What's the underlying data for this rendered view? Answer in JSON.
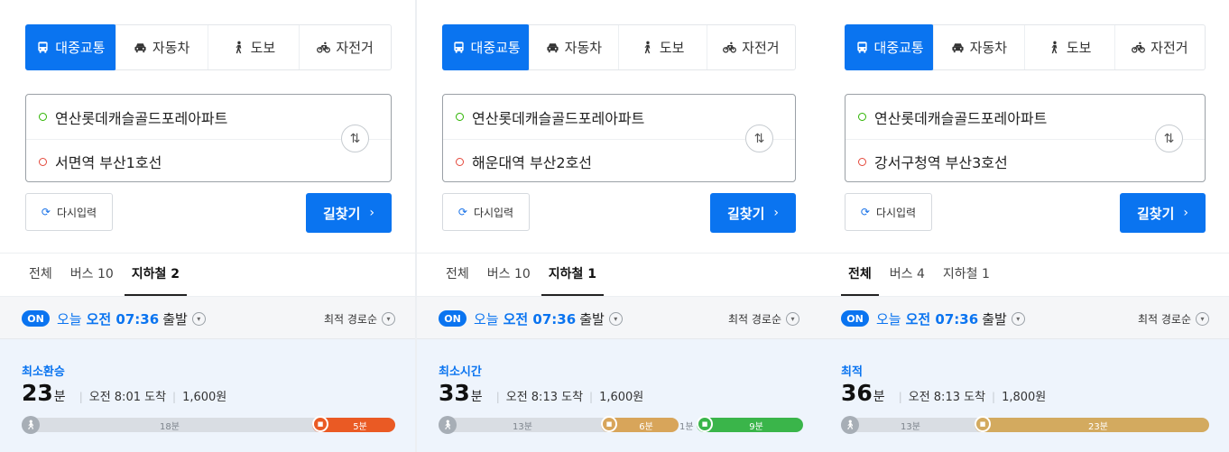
{
  "colors": {
    "primary": "#0a74f0",
    "start_dot": "#2db400",
    "end_dot": "#e4483b",
    "walk": "#d9dde3",
    "bus_orange": "#ea5a24",
    "subway_line2": "#d8a55a",
    "subway_line1": "#3ab54a",
    "subway_line3": "#d3aa5f"
  },
  "panels": [
    {
      "modes": [
        {
          "label": "대중교통",
          "icon": "bus-icon"
        },
        {
          "label": "자동차",
          "icon": "car-icon"
        },
        {
          "label": "도보",
          "icon": "walk-icon"
        },
        {
          "label": "자전거",
          "icon": "bike-icon"
        }
      ],
      "origin": "연산롯데캐슬골드포레아파트",
      "destination": "서면역 부산1호선",
      "reset_label": "다시입력",
      "search_label": "길찾기",
      "tabs": [
        {
          "label": "전체"
        },
        {
          "label": "버스 10"
        },
        {
          "label": "지하철 2"
        }
      ],
      "on_label": "ON",
      "depart": {
        "today": "오늘",
        "time": "오전 07:36",
        "suffix": "출발"
      },
      "sort_label": "최적 경로순",
      "result": {
        "label": "최소환승",
        "duration": "23",
        "duration_unit": "분",
        "arrival": "오전 8:01 도착",
        "fare": "1,600원",
        "segments": [
          {
            "type": "walk",
            "label": "18분",
            "minutes": 18
          },
          {
            "type": "bus",
            "label": "5분",
            "minutes": 5
          }
        ]
      }
    },
    {
      "modes": [
        {
          "label": "대중교통",
          "icon": "bus-icon"
        },
        {
          "label": "자동차",
          "icon": "car-icon"
        },
        {
          "label": "도보",
          "icon": "walk-icon"
        },
        {
          "label": "자전거",
          "icon": "bike-icon"
        }
      ],
      "origin": "연산롯데캐슬골드포레아파트",
      "destination": "해운대역 부산2호선",
      "reset_label": "다시입력",
      "search_label": "길찾기",
      "tabs": [
        {
          "label": "전체"
        },
        {
          "label": "버스 10"
        },
        {
          "label": "지하철 1"
        }
      ],
      "on_label": "ON",
      "depart": {
        "today": "오늘",
        "time": "오전 07:36",
        "suffix": "출발"
      },
      "sort_label": "최적 경로순",
      "result": {
        "label": "최소시간",
        "duration": "33",
        "duration_unit": "분",
        "arrival": "오전 8:13 도착",
        "fare": "1,600원",
        "segments": [
          {
            "type": "walk",
            "label": "13분",
            "minutes": 13
          },
          {
            "type": "subway2",
            "label": "6분",
            "minutes": 6
          },
          {
            "type": "walk",
            "label": "1분",
            "minutes": 1
          },
          {
            "type": "subway1",
            "label": "9분",
            "minutes": 9
          }
        ]
      }
    },
    {
      "modes": [
        {
          "label": "대중교통",
          "icon": "bus-icon"
        },
        {
          "label": "자동차",
          "icon": "car-icon"
        },
        {
          "label": "도보",
          "icon": "walk-icon"
        },
        {
          "label": "자전거",
          "icon": "bike-icon"
        }
      ],
      "origin": "연산롯데캐슬골드포레아파트",
      "destination": "강서구청역 부산3호선",
      "reset_label": "다시입력",
      "search_label": "길찾기",
      "tabs": [
        {
          "label": "전체"
        },
        {
          "label": "버스 4"
        },
        {
          "label": "지하철 1"
        }
      ],
      "on_label": "ON",
      "depart": {
        "today": "오늘",
        "time": "오전 07:36",
        "suffix": "출발"
      },
      "sort_label": "최적 경로순",
      "result": {
        "label": "최적",
        "duration": "36",
        "duration_unit": "분",
        "arrival": "오전 8:13 도착",
        "fare": "1,800원",
        "segments": [
          {
            "type": "walk",
            "label": "13분",
            "minutes": 13
          },
          {
            "type": "subway3",
            "label": "23분",
            "minutes": 23
          }
        ]
      }
    }
  ]
}
